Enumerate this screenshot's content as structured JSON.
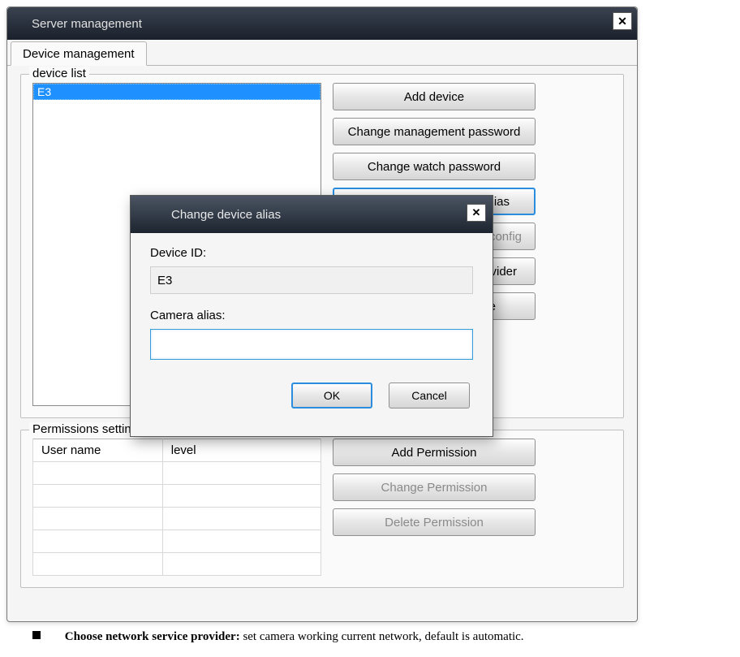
{
  "main": {
    "title": "Server management",
    "tabs": [
      {
        "label": "Device management"
      }
    ]
  },
  "deviceList": {
    "label": "device list",
    "items": [
      {
        "id": "E3"
      }
    ]
  },
  "buttons": {
    "add": "Add device",
    "changeMgmtPw": "Change management password",
    "changeWatchPw": "Change watch password",
    "alias": "alias",
    "config": "config",
    "provider": "ovider",
    "vice": "vice"
  },
  "permissions": {
    "label": "Permissions setting",
    "columns": {
      "user": "User name",
      "level": "level"
    },
    "buttons": {
      "add": "Add Permission",
      "change": "Change Permission",
      "delete": "Delete Permission"
    }
  },
  "modal": {
    "title": "Change device alias",
    "deviceIdLabel": "Device ID:",
    "deviceId": "E3",
    "aliasLabel": "Camera alias:",
    "aliasValue": "",
    "ok": "OK",
    "cancel": "Cancel"
  },
  "footnote": {
    "bold": "Choose network service provider:",
    "rest": " set camera working current network, default is automatic."
  }
}
